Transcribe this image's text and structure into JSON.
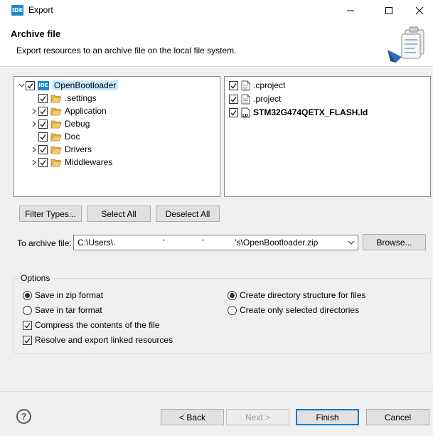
{
  "window": {
    "icon_text": "IDE",
    "title": "Export"
  },
  "header": {
    "title": "Archive file",
    "description": "Export resources to an archive file on the local file system."
  },
  "tree": {
    "root": {
      "label": "OpenBootloader",
      "icon_text": "IDE",
      "checked": true,
      "expanded": true
    },
    "children": [
      {
        "label": ".settings",
        "checked": true,
        "expandable": false
      },
      {
        "label": "Application",
        "checked": true,
        "expandable": true
      },
      {
        "label": "Debug",
        "checked": true,
        "expandable": true
      },
      {
        "label": "Doc",
        "checked": true,
        "expandable": false
      },
      {
        "label": "Drivers",
        "checked": true,
        "expandable": true
      },
      {
        "label": "Middlewares",
        "checked": true,
        "expandable": true
      }
    ]
  },
  "files": [
    {
      "label": ".cproject",
      "checked": true,
      "bold": false,
      "icon": "file-icon"
    },
    {
      "label": ".project",
      "checked": true,
      "bold": false,
      "icon": "file-icon"
    },
    {
      "label": "STM32G474QETX_FLASH.ld",
      "checked": true,
      "bold": true,
      "icon": "linker-file-icon",
      "icon_text": "LD"
    }
  ],
  "selection_buttons": {
    "filter_types": "Filter Types...",
    "select_all": "Select All",
    "deselect_all": "Deselect All"
  },
  "archive": {
    "label": "To archive file:",
    "value": "C:\\Users\\.                    '                '             's\\OpenBootloader.zip",
    "browse": "Browse..."
  },
  "options": {
    "group_label": "Options",
    "format_zip": "Save in zip format",
    "format_tar": "Save in tar format",
    "format_selected": "zip",
    "compress": "Compress the contents of the file",
    "compress_checked": true,
    "resolve_links": "Resolve and export linked resources",
    "resolve_checked": true,
    "create_dir_structure": "Create directory structure for files",
    "create_selected_dirs": "Create only selected directories",
    "structure_selected": "dir_structure"
  },
  "footer": {
    "help_symbol": "?",
    "back": "< Back",
    "next": "Next >",
    "finish": "Finish",
    "cancel": "Cancel"
  },
  "colors": {
    "selection": "#cce8ff",
    "folder": "#e8b84a",
    "ide_icon": "#1e88c8",
    "default_button_border": "#0078d7"
  }
}
